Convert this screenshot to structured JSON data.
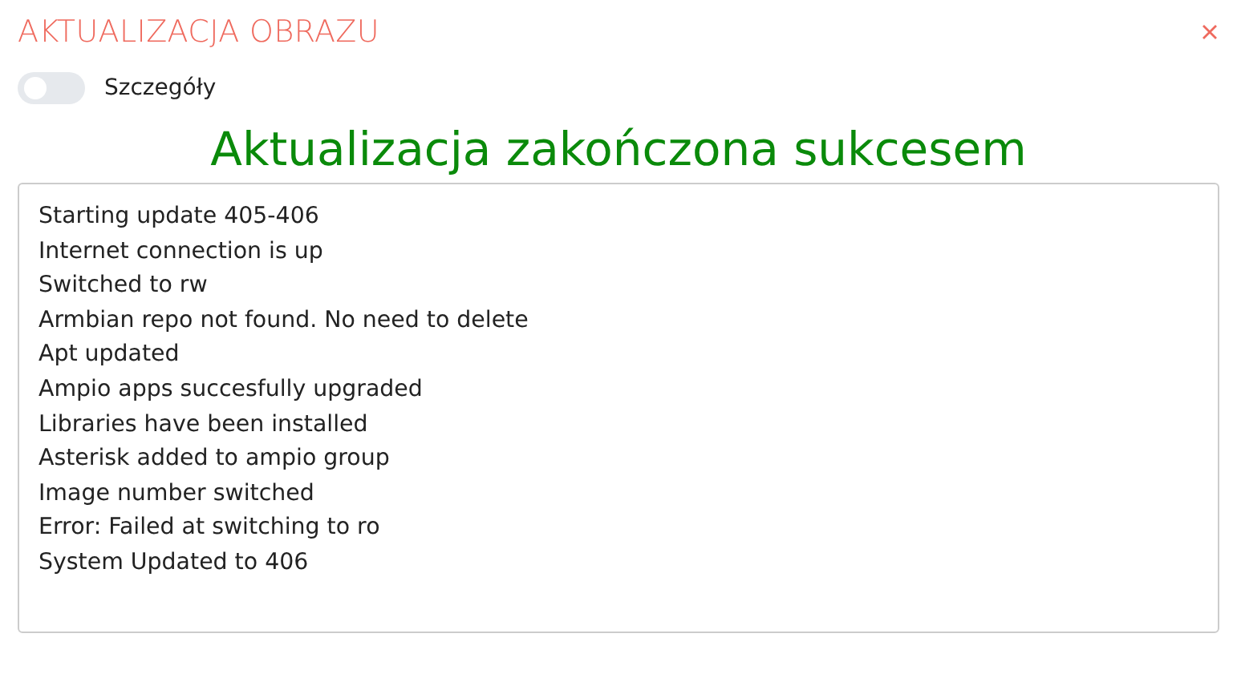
{
  "dialog": {
    "title": "AKTUALIZACJA OBRAZU"
  },
  "details_toggle": {
    "label": "Szczegóły",
    "on": false
  },
  "status_heading": "Aktualizacja zakończona sukcesem",
  "log_lines": [
    "Starting update 405-406",
    "Internet connection is up",
    "Switched to rw",
    "Armbian repo not found. No need to delete",
    "Apt updated",
    "Ampio apps succesfully upgraded",
    "Libraries have been installed",
    "Asterisk added to ampio group",
    "Image number switched",
    "Error: Failed at switching to ro",
    "System Updated to 406"
  ]
}
